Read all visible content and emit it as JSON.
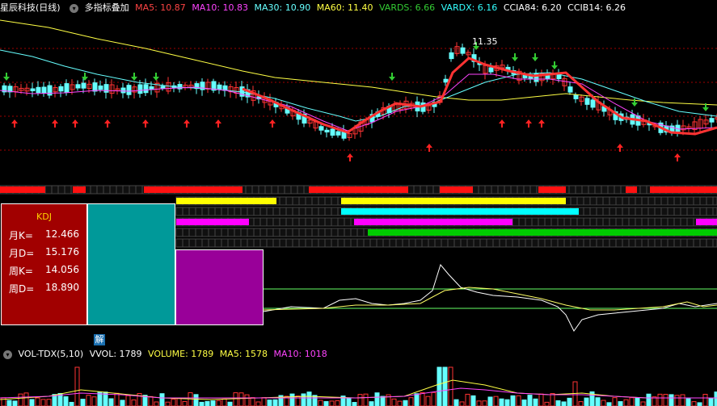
{
  "header": {
    "stock_name": "星辰科技(日线)",
    "indicator_name": "多指标叠加",
    "ma5_label": "MA5: 10.87",
    "ma10_label": "MA10: 10.83",
    "ma30_label": "MA30: 10.90",
    "ma60_label": "MA60: 11.40",
    "vards_label": "VARDS: 6.66",
    "vardx_label": "VARDX: 6.16",
    "ccia84_label": "CCIA84: 6.20",
    "ccib14_label": "CCIB14: 6.26"
  },
  "price_annotation": "11.35",
  "kdj": {
    "title": "KDJ",
    "rows": [
      {
        "label": "月K=",
        "value": "12.466"
      },
      {
        "label": "月D=",
        "value": "15.176"
      },
      {
        "label": "周K=",
        "value": "14.056"
      },
      {
        "label": "周D=",
        "value": "18.890"
      }
    ]
  },
  "jie_button": "解",
  "volume_header": {
    "indicator": "VOL-TDX(5,10)",
    "vvol": "VVOL: 1789",
    "volume": "VOLUME: 1789",
    "ma5": "MA5: 1578",
    "ma10": "MA10: 1018"
  },
  "colors": {
    "ma5": "#ff4444",
    "ma10": "#ff44ff",
    "ma30": "#66ffff",
    "ma60": "#ffff44",
    "vards": "#33cc33",
    "vardx": "#33ffff",
    "text": "#ffffff",
    "grid_line": "#a00000"
  }
}
